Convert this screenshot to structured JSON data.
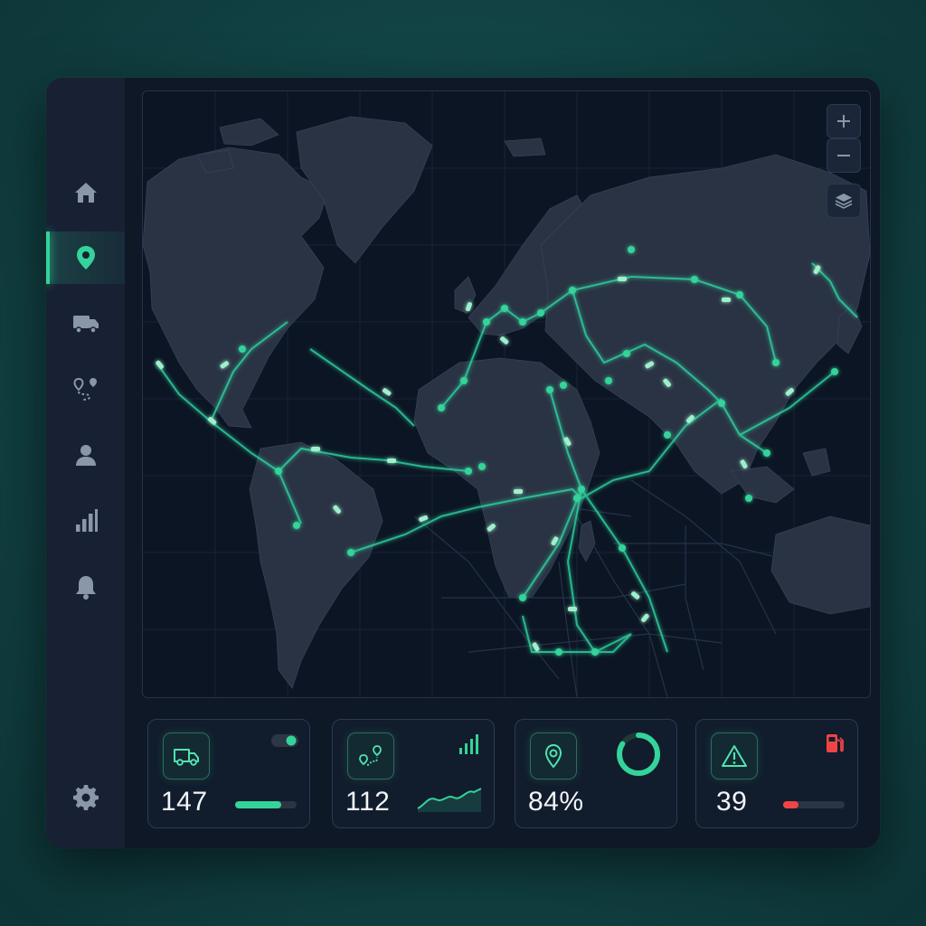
{
  "sidebar": {
    "items": [
      {
        "id": "home",
        "icon": "home-icon",
        "active": false
      },
      {
        "id": "map",
        "icon": "location-pin-icon",
        "active": true
      },
      {
        "id": "fleet",
        "icon": "truck-icon",
        "active": false
      },
      {
        "id": "routes",
        "icon": "route-icon",
        "active": false
      },
      {
        "id": "drivers",
        "icon": "user-icon",
        "active": false
      },
      {
        "id": "analytics",
        "icon": "bar-chart-icon",
        "active": false
      },
      {
        "id": "alerts",
        "icon": "bell-icon",
        "active": false
      }
    ],
    "footer_icon": "gear-icon"
  },
  "map": {
    "controls": [
      "zoom-in-icon",
      "zoom-out-icon",
      "layers-icon"
    ]
  },
  "stats": {
    "vehicles": {
      "value": "147",
      "icon": "truck-icon",
      "indicator": "toggle-on",
      "progress": 0.75
    },
    "routes": {
      "value": "112",
      "icon": "route-icon",
      "indicator": "signal-bars-icon"
    },
    "on_time": {
      "value": "84%",
      "icon": "location-pin-icon",
      "indicator": "ring-progress",
      "progress": 0.84
    },
    "alerts": {
      "value": "39",
      "icon": "warning-icon",
      "indicator": "fuel-icon",
      "progress": 0.25
    }
  },
  "colors": {
    "accent": "#34d399",
    "alert": "#ef4444",
    "panel": "#0f1826",
    "sidebar": "#172133",
    "land": "#2a3344"
  }
}
